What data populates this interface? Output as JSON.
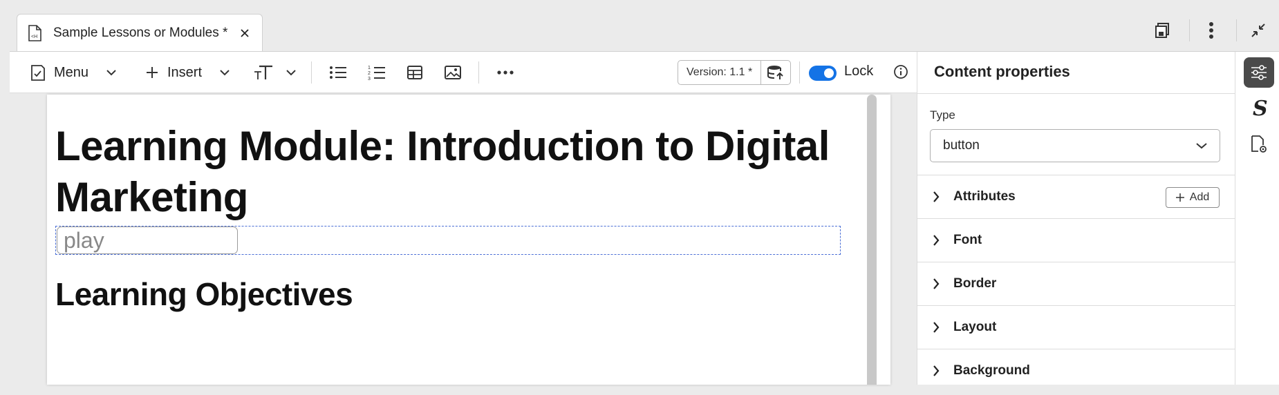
{
  "tab": {
    "title": "Sample Lessons or Modules *",
    "close_icon": "close-icon"
  },
  "window_actions": [
    "save-copy-icon",
    "more-vertical-icon",
    "collapse-icon"
  ],
  "toolbar": {
    "menu_label": "Menu",
    "insert_label": "Insert",
    "version_label": "Version: 1.1 *",
    "lock_label": "Lock",
    "lock_enabled": true,
    "accent": "#1473e6"
  },
  "document": {
    "title": "Learning Module: Introduction to Digital Marketing",
    "button_text": "play",
    "heading_2": "Learning Objectives"
  },
  "panel": {
    "title": "Content properties",
    "type_label": "Type",
    "type_value": "button",
    "sections": [
      "Attributes",
      "Font",
      "Border",
      "Layout",
      "Background"
    ],
    "add_label": "Add"
  },
  "rail": {
    "icons": [
      "sliders-icon",
      "style-s-icon",
      "document-settings-icon"
    ],
    "active": "sliders-icon"
  }
}
